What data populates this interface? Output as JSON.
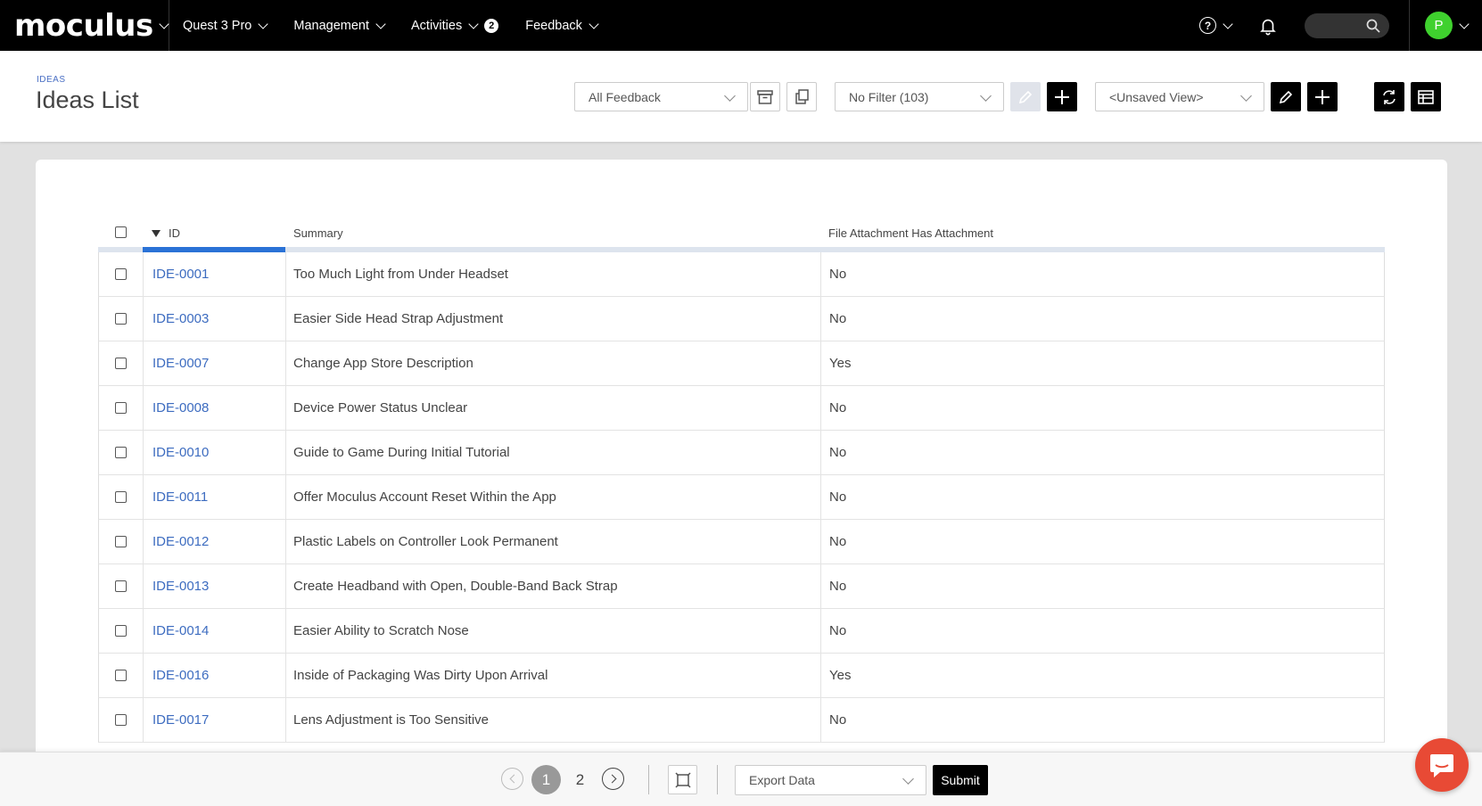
{
  "nav": {
    "brand": "moculus",
    "items": [
      {
        "label": "Quest 3 Pro",
        "badge": ""
      },
      {
        "label": "Management",
        "badge": ""
      },
      {
        "label": "Activities",
        "badge": "2"
      },
      {
        "label": "Feedback",
        "badge": ""
      }
    ],
    "avatar_initial": "P",
    "avatar_color": "#3fd12e"
  },
  "header": {
    "breadcrumb": "IDEAS",
    "title": "Ideas List",
    "feedback_select": "All Feedback",
    "filter_select": "No Filter (103)",
    "view_select": "<Unsaved View>"
  },
  "table": {
    "columns": [
      "ID",
      "Summary",
      "File Attachment Has Attachment"
    ],
    "rows": [
      {
        "id": "IDE-0001",
        "summary": "Too Much Light from Under Headset",
        "attachment": "No"
      },
      {
        "id": "IDE-0003",
        "summary": "Easier Side Head Strap Adjustment",
        "attachment": "No"
      },
      {
        "id": "IDE-0007",
        "summary": "Change App Store Description",
        "attachment": "Yes"
      },
      {
        "id": "IDE-0008",
        "summary": "Device Power Status Unclear",
        "attachment": "No"
      },
      {
        "id": "IDE-0010",
        "summary": "Guide to Game During Initial Tutorial",
        "attachment": "No"
      },
      {
        "id": "IDE-0011",
        "summary": "Offer Moculus Account Reset Within the App",
        "attachment": "No"
      },
      {
        "id": "IDE-0012",
        "summary": "Plastic Labels on Controller Look Permanent",
        "attachment": "No"
      },
      {
        "id": "IDE-0013",
        "summary": "Create Headband with Open, Double-Band Back Strap",
        "attachment": "No"
      },
      {
        "id": "IDE-0014",
        "summary": "Easier Ability to Scratch Nose",
        "attachment": "No"
      },
      {
        "id": "IDE-0016",
        "summary": "Inside of Packaging Was Dirty Upon Arrival",
        "attachment": "Yes"
      },
      {
        "id": "IDE-0017",
        "summary": "Lens Adjustment is Too Sensitive",
        "attachment": "No"
      }
    ]
  },
  "footer": {
    "pages": [
      "1",
      "2"
    ],
    "current_page": "1",
    "export_select": "Export Data",
    "submit_label": "Submit"
  },
  "colors": {
    "accent": "#2a72d6",
    "link": "#3d6cc0",
    "chat": "#e84a35"
  }
}
